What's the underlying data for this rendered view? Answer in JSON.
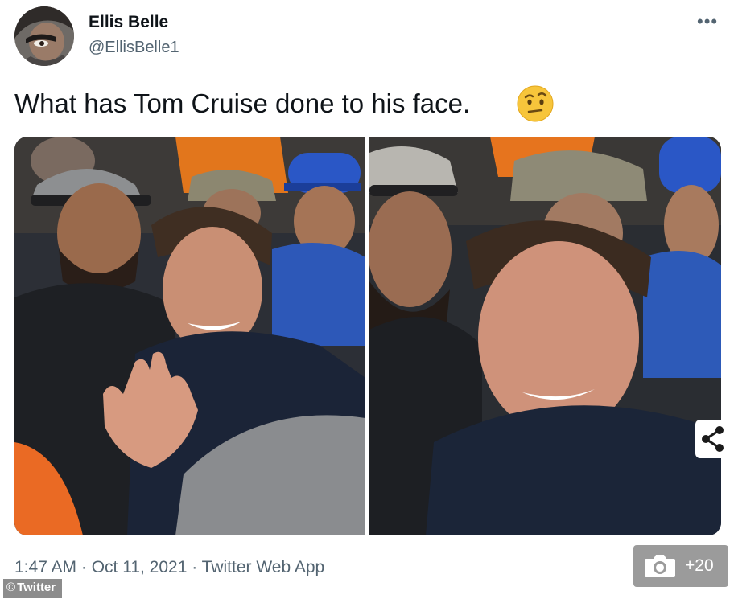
{
  "tweet": {
    "author": {
      "display_name": "Ellis Belle",
      "handle": "@EllisBelle1"
    },
    "more_label": "•••",
    "text": "What has Tom Cruise done to his face.",
    "emoji": "face-with-raised-eyebrow",
    "media": [
      {
        "kind": "photo",
        "subject": "man in navy jacket waving in crowd"
      },
      {
        "kind": "photo",
        "subject": "man in navy jacket smiling close-up"
      }
    ],
    "timestamp": "1:47 AM · Oct 11, 2021 · Twitter Web App"
  },
  "overlay": {
    "share_icon": "share-icon",
    "gallery_icon": "camera-icon",
    "gallery_count": "+20",
    "credit": "Twitter",
    "credit_symbol": "©"
  },
  "colors": {
    "text_primary": "#0f1419",
    "text_secondary": "#536471",
    "gallery_bg": "#9b9b9b",
    "credit_bg": "#8c8c8c"
  }
}
